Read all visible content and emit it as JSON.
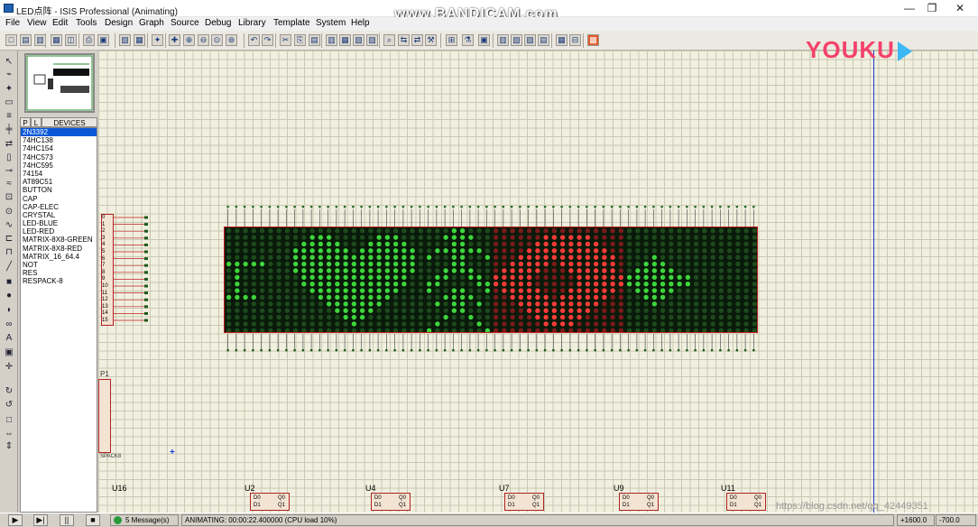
{
  "window": {
    "title": "LED点阵 - ISIS Professional (Animating)",
    "minimize": "—",
    "restore": "❐",
    "close": "✕"
  },
  "watermark": "www.BANDICAM.com",
  "youku": "YOUKU",
  "menu": [
    "File",
    "View",
    "Edit",
    "Tools",
    "Design",
    "Graph",
    "Source",
    "Debug",
    "Library",
    "Template",
    "System",
    "Help"
  ],
  "device_tabs": {
    "p": "P",
    "l": "L",
    "title": "DEVICES"
  },
  "devices": [
    "2N3392",
    "74HC138",
    "74HC154",
    "74HC573",
    "74HC595",
    "74154",
    "AT89C51",
    "BUTTON",
    "CAP",
    "CAP-ELEC",
    "CRYSTAL",
    "LED-BLUE",
    "LED-RED",
    "MATRIX-8X8-GREEN",
    "MATRIX-8X8-RED",
    "MATRIX_16_64.4",
    "NOT",
    "RES",
    "RESPACK-8"
  ],
  "selected_device": "2N3392",
  "schematic": {
    "p1_label": "P1",
    "respack_label": "SPACK8",
    "chip_labels": [
      "U16",
      "U2",
      "U4",
      "U7",
      "U9",
      "U11"
    ],
    "left_pins": [
      "0",
      "1",
      "2",
      "3",
      "4",
      "5",
      "6",
      "7",
      "8",
      "9",
      "10",
      "11",
      "12",
      "13",
      "14",
      "15"
    ],
    "chip_pin_d0": "D0",
    "chip_pin_d1": "D1",
    "chip_pin_q0": "Q0",
    "chip_pin_q1": "Q1"
  },
  "colors": {
    "led_off": "#1d4a1d",
    "led_green": "#3dd63d",
    "led_red_off": "#7a1a1a",
    "led_red_on": "#ff3b3b",
    "grid_bg": "#f1f0e0"
  },
  "status": {
    "messages": "5 Message(s)",
    "animating": "ANIMATING: 00:00:22.400000 (CPU load 10%)",
    "coord_x": "+1600.0",
    "coord_y": "-700.0"
  },
  "csdn_watermark": "https://blog.csdn.net/qq_42449351"
}
